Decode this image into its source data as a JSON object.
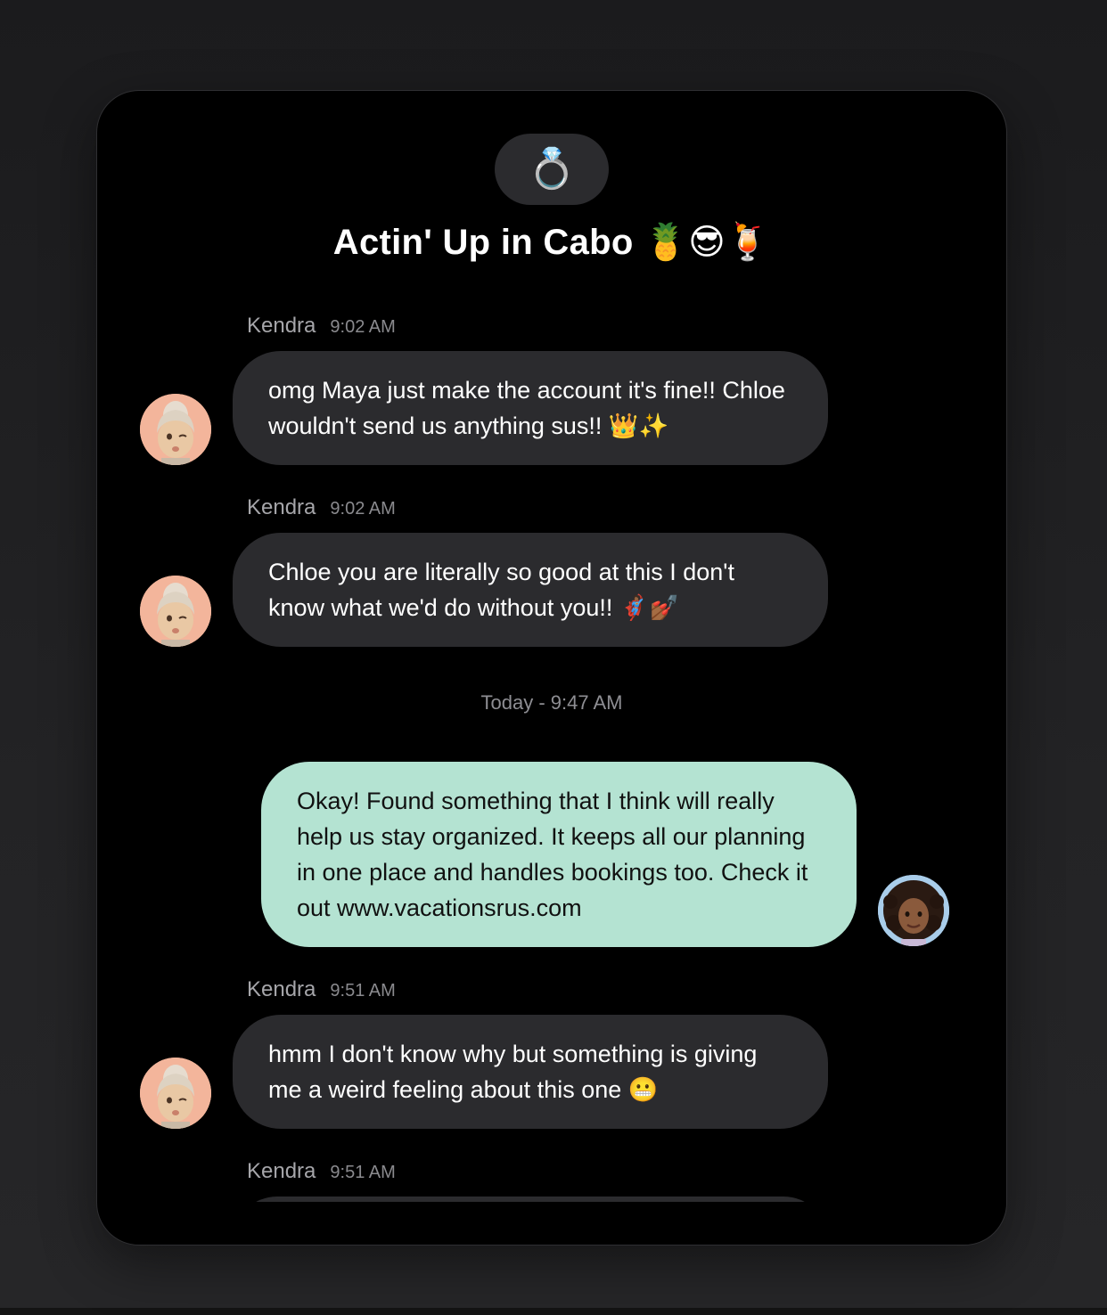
{
  "group": {
    "icon_emoji": "💍",
    "title": "Actin' Up in Cabo 🍍😎🍹"
  },
  "messages": [
    {
      "sender": "Kendra",
      "time": "9:02 AM",
      "text": "omg Maya just make the account it's fine!! Chloe wouldn't send us anything sus!! 👑✨"
    },
    {
      "sender": "Kendra",
      "time": "9:02 AM",
      "text": "Chloe you are literally so good at this I don't know what we'd do without you!! 🦸🏾‍♀️💅🏾"
    },
    {
      "text": "Okay! Found something that I think will really help us stay organized. It keeps all our planning in one place and handles bookings too. Check it out www.vacationsrus.com"
    },
    {
      "sender": "Kendra",
      "time": "9:51 AM",
      "text": "hmm I don't know why but something is giving me a weird feeling about this one 😬"
    },
    {
      "sender": "Kendra",
      "time": "9:51 AM"
    }
  ],
  "divider": {
    "label": "Today - 9:47 AM"
  },
  "colors": {
    "incoming_bubble": "#2b2b2e",
    "outgoing_bubble": "#b4e3d2",
    "card_background": "#000000"
  }
}
